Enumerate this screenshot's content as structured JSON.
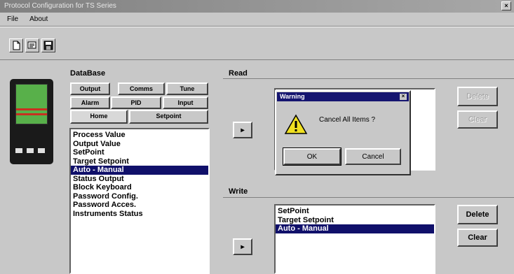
{
  "window": {
    "title": "Protocol Configuration for TS Series",
    "close_glyph": "×"
  },
  "menu": [
    {
      "label": "File"
    },
    {
      "label": "About"
    }
  ],
  "toolbar": {
    "icons": [
      "new-file-icon",
      "open-folder-icon",
      "save-disk-icon"
    ]
  },
  "database": {
    "label": "DataBase",
    "tabs_row1": [
      "Output",
      "Comms",
      "Tune"
    ],
    "tabs_row2": [
      "Alarm",
      "PID",
      "Input"
    ],
    "tabs_row3": [
      "Home",
      "Setpoint"
    ],
    "active_tab": "Home",
    "items": [
      {
        "label": "Process Value",
        "selected": false
      },
      {
        "label": "Output Value",
        "selected": false
      },
      {
        "label": "SetPoint",
        "selected": false
      },
      {
        "label": "Target Setpoint",
        "selected": false
      },
      {
        "label": "Auto - Manual",
        "selected": true
      },
      {
        "label": "Status Output",
        "selected": false
      },
      {
        "label": "Block Keyboard",
        "selected": false
      },
      {
        "label": "Password Config.",
        "selected": false
      },
      {
        "label": "Password Acces.",
        "selected": false
      },
      {
        "label": "Instruments Status",
        "selected": false
      }
    ]
  },
  "read": {
    "label": "Read",
    "arrow": "▸",
    "delete_label": "Delete",
    "clear_label": "Clear"
  },
  "write": {
    "label": "Write",
    "arrow": "▸",
    "items": [
      {
        "label": "SetPoint",
        "selected": false
      },
      {
        "label": "Target Setpoint",
        "selected": false
      },
      {
        "label": "Auto - Manual",
        "selected": true
      }
    ],
    "delete_label": "Delete",
    "clear_label": "Clear"
  },
  "dialog": {
    "title": "Warning",
    "close_glyph": "×",
    "message": "Cancel All Items ?",
    "icon": "warning-icon",
    "ok_label": "OK",
    "cancel_label": "Cancel"
  },
  "colors": {
    "selection": "#10106a",
    "dialog_title": "#151570",
    "device_screen": "#58b04a"
  }
}
